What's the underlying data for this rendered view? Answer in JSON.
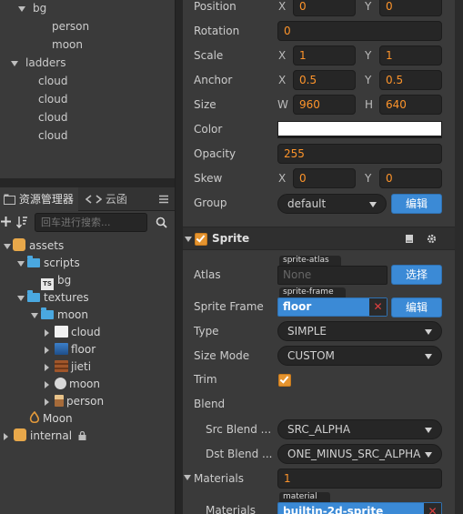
{
  "node_tree": {
    "items": [
      {
        "label": "bg",
        "expanded": true
      },
      {
        "label": "person"
      },
      {
        "label": "moon"
      },
      {
        "label": "ladders",
        "expanded": true
      },
      {
        "label": "cloud"
      },
      {
        "label": "cloud"
      },
      {
        "label": "cloud"
      },
      {
        "label": "cloud"
      }
    ]
  },
  "assets_panel": {
    "tabs": [
      {
        "label": "资源管理器",
        "active": true
      },
      {
        "label": "云函"
      }
    ],
    "search_placeholder": "回车进行搜索...",
    "tree": [
      {
        "label": "assets",
        "type": "db"
      },
      {
        "label": "scripts",
        "type": "folder"
      },
      {
        "label": "bg",
        "type": "ts"
      },
      {
        "label": "textures",
        "type": "folder"
      },
      {
        "label": "moon",
        "type": "folder"
      },
      {
        "label": "cloud",
        "type": "image"
      },
      {
        "label": "floor",
        "type": "image"
      },
      {
        "label": "jieti",
        "type": "image"
      },
      {
        "label": "moon",
        "type": "image"
      },
      {
        "label": "person",
        "type": "image"
      },
      {
        "label": "Moon",
        "type": "scene"
      },
      {
        "label": "internal",
        "type": "db",
        "locked": true
      }
    ]
  },
  "inspector": {
    "position": {
      "label": "Position",
      "x_axis": "X",
      "x": "0",
      "y_axis": "Y",
      "y": "0"
    },
    "rotation": {
      "label": "Rotation",
      "value": "0"
    },
    "scale": {
      "label": "Scale",
      "x_axis": "X",
      "x": "1",
      "y_axis": "Y",
      "y": "1"
    },
    "anchor": {
      "label": "Anchor",
      "x_axis": "X",
      "x": "0.5",
      "y_axis": "Y",
      "y": "0.5"
    },
    "size": {
      "label": "Size",
      "w_axis": "W",
      "w": "960",
      "h_axis": "H",
      "h": "640"
    },
    "color": {
      "label": "Color",
      "value": "#ffffff"
    },
    "opacity": {
      "label": "Opacity",
      "value": "255"
    },
    "skew": {
      "label": "Skew",
      "x_axis": "X",
      "x": "0",
      "y_axis": "Y",
      "y": "0"
    },
    "group": {
      "label": "Group",
      "value": "default",
      "edit_label": "编辑"
    },
    "sprite_section": {
      "title": "Sprite",
      "enabled": true
    },
    "atlas": {
      "label": "Atlas",
      "tag": "sprite-atlas",
      "value": "None",
      "button": "选择"
    },
    "sprite_frame": {
      "label": "Sprite Frame",
      "tag": "sprite-frame",
      "value": "floor",
      "button": "编辑"
    },
    "type": {
      "label": "Type",
      "value": "SIMPLE"
    },
    "size_mode": {
      "label": "Size Mode",
      "value": "CUSTOM"
    },
    "trim": {
      "label": "Trim",
      "checked": true
    },
    "blend": {
      "label": "Blend"
    },
    "src_blend": {
      "label": "Src Blend ...",
      "value": "SRC_ALPHA"
    },
    "dst_blend": {
      "label": "Dst Blend ...",
      "value": "ONE_MINUS_SRC_ALPHA"
    },
    "materials": {
      "label": "Materials",
      "count": "1"
    },
    "material_item": {
      "label": "Materials",
      "tag": "material",
      "value": "builtin-2d-sprite"
    }
  },
  "colors": {
    "accent_orange": "#fd942b",
    "button_blue": "#3b8ad6",
    "folder_blue": "#4aa8e0",
    "panel_bg": "#3a3a3a"
  }
}
